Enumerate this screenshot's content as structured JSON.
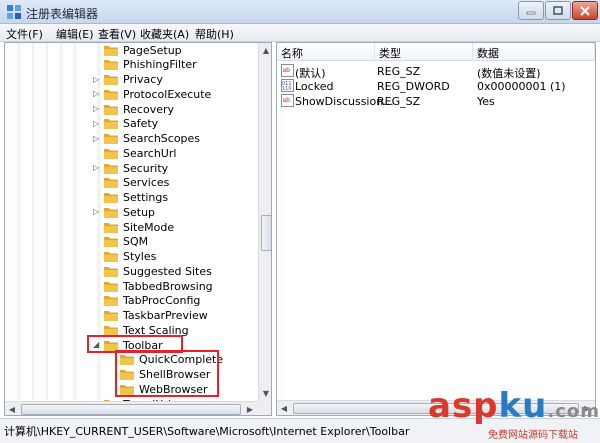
{
  "window": {
    "title": "注册表编辑器"
  },
  "menu": [
    "文件(F)",
    "编辑(E)",
    "查看(V)",
    "收藏夹(A)",
    "帮助(H)"
  ],
  "tree": {
    "items": [
      {
        "label": "PageSetup",
        "expander": ""
      },
      {
        "label": "PhishingFilter",
        "expander": ""
      },
      {
        "label": "Privacy",
        "expander": "▷"
      },
      {
        "label": "ProtocolExecute",
        "expander": "▷"
      },
      {
        "label": "Recovery",
        "expander": "▷"
      },
      {
        "label": "Safety",
        "expander": "▷"
      },
      {
        "label": "SearchScopes",
        "expander": "▷"
      },
      {
        "label": "SearchUrl",
        "expander": ""
      },
      {
        "label": "Security",
        "expander": "▷"
      },
      {
        "label": "Services",
        "expander": ""
      },
      {
        "label": "Settings",
        "expander": ""
      },
      {
        "label": "Setup",
        "expander": "▷"
      },
      {
        "label": "SiteMode",
        "expander": ""
      },
      {
        "label": "SQM",
        "expander": ""
      },
      {
        "label": "Styles",
        "expander": ""
      },
      {
        "label": "Suggested Sites",
        "expander": ""
      },
      {
        "label": "TabbedBrowsing",
        "expander": ""
      },
      {
        "label": "TabProcConfig",
        "expander": ""
      },
      {
        "label": "TaskbarPreview",
        "expander": ""
      },
      {
        "label": "Text Scaling",
        "expander": ""
      },
      {
        "label": "Toolbar",
        "expander": "◢"
      },
      {
        "label": "QuickComplete",
        "expander": ""
      },
      {
        "label": "ShellBrowser",
        "expander": ""
      },
      {
        "label": "WebBrowser",
        "expander": ""
      },
      {
        "label": "TypedUrls",
        "expander": ""
      }
    ]
  },
  "list": {
    "columns": [
      "名称",
      "类型",
      "数据"
    ],
    "rows": [
      {
        "icon": "string-value-icon",
        "name": "(默认)",
        "type": "REG_SZ",
        "data": "(数值未设置)"
      },
      {
        "icon": "dword-value-icon",
        "name": "Locked",
        "type": "REG_DWORD",
        "data": "0x00000001 (1)"
      },
      {
        "icon": "string-value-icon",
        "name": "ShowDiscussion...",
        "type": "REG_SZ",
        "data": "Yes"
      }
    ]
  },
  "status": {
    "path": "计算机\\HKEY_CURRENT_USER\\Software\\Microsoft\\Internet Explorer\\Toolbar"
  },
  "watermark": {
    "main_a": "asp",
    "main_b": "ku",
    "main_c": ".com",
    "sub": "免费网站源码下载站"
  },
  "colors": {
    "highlight": "#e8202a",
    "folder": "#f3c44b"
  }
}
